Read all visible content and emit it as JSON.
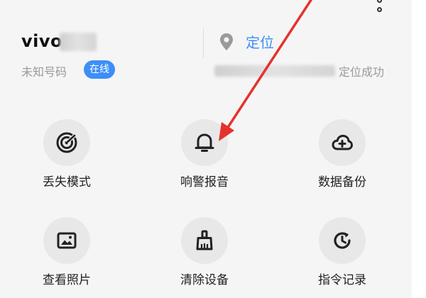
{
  "device": {
    "name": "vivo",
    "number_label": "未知号码",
    "status_badge": "在线"
  },
  "location": {
    "link_label": "定位",
    "status_text": "定位成功"
  },
  "functions": [
    {
      "label": "丢失模式",
      "icon": "radar-icon"
    },
    {
      "label": "响警报音",
      "icon": "bell-icon"
    },
    {
      "label": "数据备份",
      "icon": "cloud-upload-icon"
    },
    {
      "label": "查看照片",
      "icon": "photo-icon"
    },
    {
      "label": "清除设备",
      "icon": "broom-icon"
    },
    {
      "label": "指令记录",
      "icon": "history-icon"
    }
  ],
  "colors": {
    "accent": "#3d8ef8",
    "annotation_arrow": "#e5322d",
    "background": "#f5f5f5",
    "icon_circle": "#e8e8e8"
  }
}
